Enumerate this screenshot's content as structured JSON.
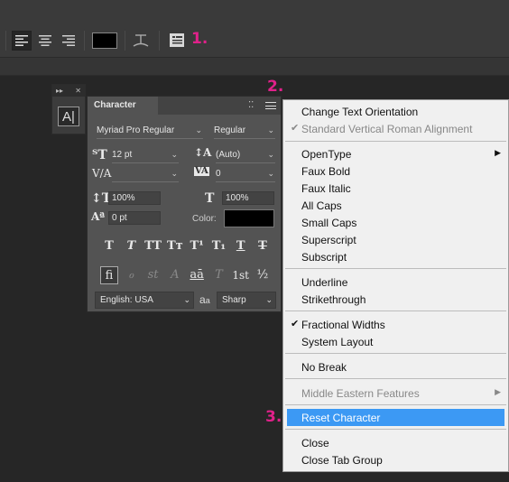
{
  "options_bar": {
    "align_left_icon": "align-left-icon",
    "align_center_icon": "align-center-icon",
    "align_right_icon": "align-right-icon",
    "text_color": "#000000",
    "warp_icon": "warp-text-icon",
    "panels_icon": "character-panels-icon"
  },
  "steps": {
    "one": "1.",
    "two": "2.",
    "three": "3."
  },
  "dock": {
    "expand": "▸▸",
    "close": "✕",
    "button_label": "A|"
  },
  "panel": {
    "tab": "Character",
    "font_family": "Myriad Pro Regular",
    "font_style": "Regular",
    "font_size": "12 pt",
    "leading": "(Auto)",
    "kerning": "",
    "tracking": "0",
    "vertical_scale": "100%",
    "horizontal_scale": "100%",
    "baseline_shift": "0 pt",
    "color_label": "Color:",
    "language": "English: USA",
    "antialias": "Sharp",
    "antialias_icon_label": "a",
    "antialias_icon_sub": "a",
    "style_buttons": [
      "T",
      "T",
      "TT",
      "Tт",
      "T¹",
      "T₁",
      "T",
      "T"
    ],
    "opentype_buttons": [
      "fi",
      "ℴ",
      "st",
      "A",
      "aā",
      "T",
      "1st",
      "½"
    ]
  },
  "menu": {
    "accent": "#3c99f4",
    "items": [
      {
        "label": "Change Text Orientation"
      },
      {
        "label": "Standard Vertical Roman Alignment",
        "check": "✔"
      },
      {
        "label": "OpenType",
        "arrow": "▶"
      },
      {
        "label": "Faux Bold"
      },
      {
        "label": "Faux Italic"
      },
      {
        "label": "All Caps"
      },
      {
        "label": "Small Caps"
      },
      {
        "label": "Superscript"
      },
      {
        "label": "Subscript"
      },
      {
        "label": "Underline"
      },
      {
        "label": "Strikethrough"
      },
      {
        "label": "Fractional Widths",
        "check": "✔"
      },
      {
        "label": "System Layout"
      },
      {
        "label": "No Break"
      },
      {
        "label": "Middle Eastern Features",
        "arrow": "▶"
      },
      {
        "label": "Reset Character"
      },
      {
        "label": "Close"
      },
      {
        "label": "Close Tab Group"
      }
    ]
  }
}
